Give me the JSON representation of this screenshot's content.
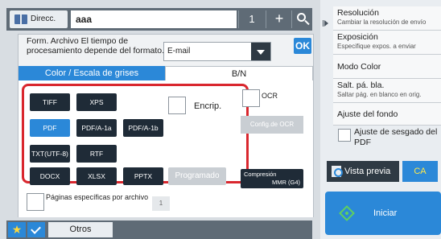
{
  "topbar": {
    "address_label": "Direcc.",
    "address_value": "aaa",
    "count": "1",
    "plus": "+"
  },
  "file_format": {
    "title": "Form. Archivo El tiempo de procesamiento depende del formato.",
    "destination_value": "E-mail",
    "ok_label": "OK",
    "tabs": [
      {
        "label": "Color / Escala de grises",
        "active": false
      },
      {
        "label": "B/N",
        "active": true
      }
    ],
    "formats": {
      "tiff": "TIFF",
      "xps": "XPS",
      "pdf": "PDF",
      "pdfa1a": "PDF/A-1a",
      "pdfa1b": "PDF/A-1b",
      "txt": "TXT(UTF-8)",
      "rtf": "RTF",
      "docx": "DOCX",
      "xlsx": "XLSX",
      "pptx": "PPTX",
      "programmed": "Programado"
    },
    "selected_format": "PDF",
    "encrypt_label": "Encrip.",
    "ocr_label": "OCR",
    "ocr_config_label": "Config.de OCR",
    "compression_label": "Compresión",
    "compression_value": "MMR (G4)",
    "pages_per_file_label": "Páginas específicas por archivo",
    "pages_per_file_value": "1"
  },
  "bottombar": {
    "star": "★",
    "otros_label": "Otros"
  },
  "right_panel": {
    "items": [
      {
        "title": "Resolución",
        "subtitle": "Cambiar la resolución de envío"
      },
      {
        "title": "Exposición",
        "subtitle": "Especifique expos. a enviar"
      },
      {
        "title": "Modo Color",
        "subtitle": ""
      },
      {
        "title": "Salt. pá. bla.",
        "subtitle": "Saltar pág. en blanco en orig."
      },
      {
        "title": "Ajuste del fondo",
        "subtitle": ""
      }
    ],
    "skew_label": "Ajuste de sesgado del PDF",
    "preview_label": "Vista previa",
    "ca_label": "CA",
    "start_label": "Iniciar"
  },
  "colors": {
    "accent": "#2b88d8",
    "highlight": "#d9272e",
    "dark_button": "#1f2b37",
    "disabled_button": "#c9ced3"
  }
}
